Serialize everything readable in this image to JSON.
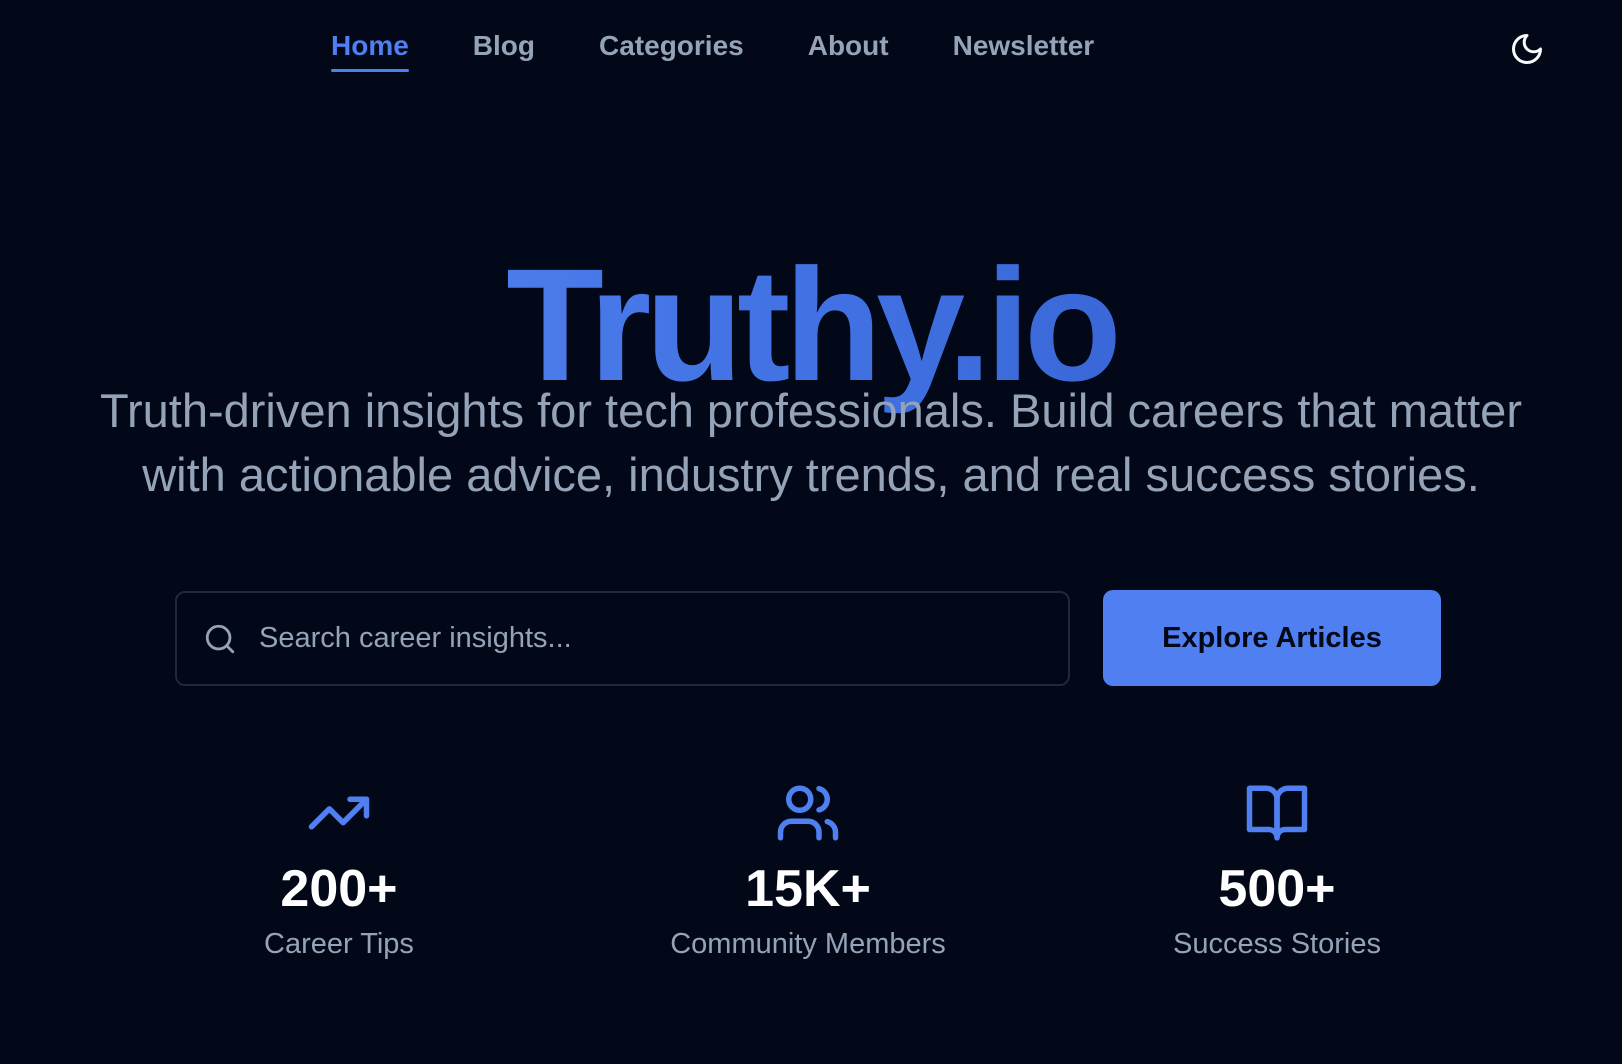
{
  "nav": {
    "items": [
      {
        "label": "Home",
        "active": true
      },
      {
        "label": "Blog",
        "active": false
      },
      {
        "label": "Categories",
        "active": false
      },
      {
        "label": "About",
        "active": false
      },
      {
        "label": "Newsletter",
        "active": false
      }
    ],
    "theme_toggle_icon": "moon-icon"
  },
  "hero": {
    "brand": "Truthy.io",
    "tagline": "Truth-driven insights for tech professionals. Build careers that matter with actionable advice, industry trends, and real success stories."
  },
  "search": {
    "placeholder": "Search career insights...",
    "value": "",
    "icon": "search-icon"
  },
  "cta": {
    "label": "Explore Articles"
  },
  "stats": [
    {
      "icon": "trending-up-icon",
      "value": "200+",
      "label": "Career Tips"
    },
    {
      "icon": "users-icon",
      "value": "15K+",
      "label": "Community Members"
    },
    {
      "icon": "book-open-icon",
      "value": "500+",
      "label": "Success Stories"
    }
  ],
  "colors": {
    "background": "#020817",
    "accent": "#4f7ff0",
    "muted_text": "#94a3b8",
    "border": "#1e293b"
  }
}
